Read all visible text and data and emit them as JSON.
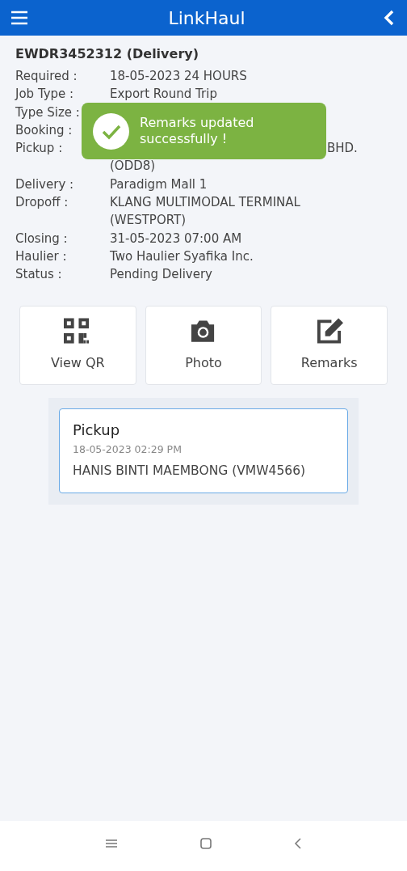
{
  "app_bar": {
    "title": "LinkHaul"
  },
  "job": {
    "title": "EWDR3452312 (Delivery)",
    "fields": [
      {
        "label": "Required :",
        "value_lines": [
          "18-05-2023 24 HOURS"
        ]
      },
      {
        "label": "Job Type :",
        "value_lines": [
          "Export Round Trip"
        ]
      },
      {
        "label": "Type Size :"
      },
      {
        "label": "Booking :"
      },
      {
        "label": "Pickup :",
        "value_lines": [
          "BHD.",
          "(ODD8)"
        ],
        "first_line_partly_covered": true
      },
      {
        "label": "Delivery :",
        "value_lines": [
          "Paradigm Mall 1"
        ]
      },
      {
        "label": "Dropoff :",
        "value_lines": [
          "KLANG MULTIMODAL TERMINAL",
          "(WESTPORT)"
        ]
      },
      {
        "label": "Closing :",
        "value_lines": [
          "31-05-2023 07:00 AM"
        ]
      },
      {
        "label": "Haulier :",
        "value_lines": [
          "Two Haulier Syafika Inc."
        ]
      },
      {
        "label": "Status :",
        "value_lines": [
          "Pending Delivery"
        ]
      }
    ]
  },
  "actions": [
    {
      "kind": "qr",
      "label": "View QR"
    },
    {
      "kind": "camera",
      "label": "Photo"
    },
    {
      "kind": "edit",
      "label": "Remarks"
    }
  ],
  "history": [
    {
      "title": "Pickup",
      "time": "18-05-2023 02:29 PM",
      "driver": "HANIS BINTI MAEMBONG (VMW4566)"
    }
  ],
  "toast": {
    "message": "Remarks updated successfully !"
  }
}
